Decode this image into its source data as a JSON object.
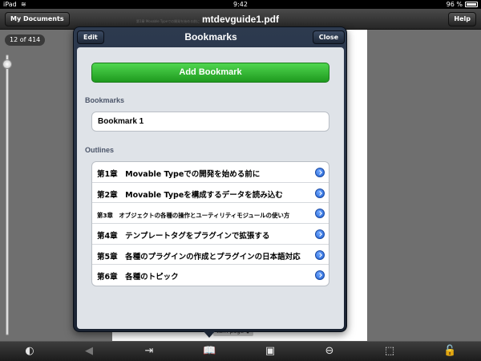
{
  "status": {
    "device": "iPad",
    "time": "9:42",
    "battery": "96 %"
  },
  "nav": {
    "back_label": "My Documents",
    "title": "mtdevguide1.pdf",
    "help_label": "Help"
  },
  "page_indicator": "12 of 414",
  "doc_snippet": "第1章 Movable Typeでの開発を始める前に",
  "turn_page_label": "turn page",
  "popover": {
    "edit_label": "Edit",
    "title": "Bookmarks",
    "close_label": "Close",
    "add_label": "Add Bookmark",
    "bookmarks_heading": "Bookmarks",
    "bookmarks": [
      "Bookmark 1"
    ],
    "outlines_heading": "Outlines",
    "outlines": [
      "第1章　Movable Typeでの開発を始める前に",
      "第2章　Movable Typeを構成するデータを読み込む",
      "第3章　オブジェクトの各種の操作とユーティリティモジュールの使い方",
      "第4章　テンプレートタグをプラグインで拡張する",
      "第5章　各種のプラグインの作成とプラグインの日本語対応",
      "第6章　各種のトピック"
    ]
  },
  "toolbar": {
    "icons": [
      "contrast-icon",
      "back-arrow-icon",
      "export-icon",
      "bookmarks-icon",
      "page-icon",
      "zoom-out-icon",
      "crop-icon",
      "lock-icon"
    ]
  },
  "colors": {
    "accent_green": "#2bb52b",
    "popover_frame": "#1b2433",
    "disclosure_blue": "#1f5fd0"
  }
}
